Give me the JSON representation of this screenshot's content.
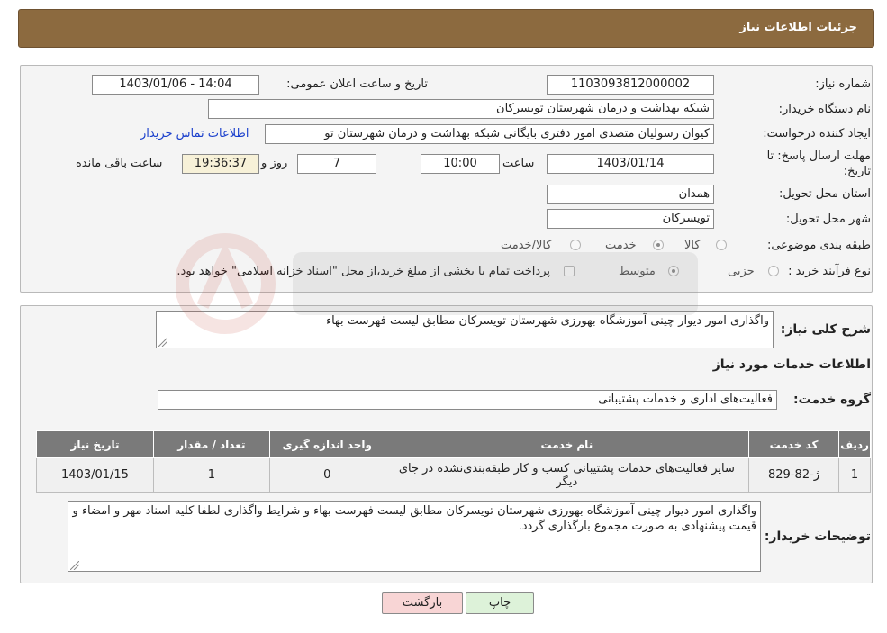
{
  "header": {
    "title": "جزئیات اطلاعات نیاز"
  },
  "form": {
    "need_number_label": "شماره نیاز:",
    "need_number": "1103093812000002",
    "announce_label": "تاریخ و ساعت اعلان عمومی:",
    "announce_value": "1403/01/06 - 14:04",
    "buyer_org_label": "نام دستگاه خریدار:",
    "buyer_org": "شبکه بهداشت و درمان شهرستان تویسرکان",
    "creator_label": "ایجاد کننده درخواست:",
    "creator": "کیوان رسولیان متصدی امور دفتری بایگانی شبکه بهداشت و درمان شهرستان تو",
    "contact_link": "اطلاعات تماس خریدار",
    "deadline_label_1": "مهلت ارسال پاسخ: تا",
    "deadline_label_2": "تاریخ:",
    "deadline_date": "1403/01/14",
    "time_label": "ساعت",
    "deadline_time": "10:00",
    "days_value": "7",
    "days_label": "روز و",
    "remaining_time": "19:36:37",
    "remaining_label": "ساعت باقی مانده",
    "province_label": "استان محل تحویل:",
    "province": "همدان",
    "city_label": "شهر محل تحویل:",
    "city": "تویسرکان",
    "category_label": "طبقه بندی موضوعی:",
    "category_options": [
      "کالا",
      "خدمت",
      "کالا/خدمت"
    ],
    "process_label": "نوع فرآیند خرید :",
    "process_options": [
      "جزیی",
      "متوسط"
    ],
    "payment_note": "پرداخت تمام یا بخشی از مبلغ خرید،از محل \"اسناد خزانه اسلامی\" خواهد بود."
  },
  "details": {
    "summary_label": "شرح کلی نیاز:",
    "summary": "واگذاری امور دیوار چینی آموزشگاه بهورزی شهرستان تویسرکان مطابق لیست فهرست بهاء",
    "services_title": "اطلاعات خدمات مورد نیاز",
    "service_group_label": "گروه خدمت:",
    "service_group": "فعالیت‌های اداری و خدمات پشتیبانی",
    "table": {
      "headers": [
        "ردیف",
        "کد خدمت",
        "نام خدمت",
        "واحد اندازه گیری",
        "تعداد / مقدار",
        "تاریخ نیاز"
      ],
      "rows": [
        [
          "1",
          "ژ-82-829",
          "سایر فعالیت‌های خدمات پشتیبانی کسب و کار طبقه‌بندی‌نشده در جای دیگر",
          "0",
          "1",
          "1403/01/15"
        ]
      ]
    },
    "buyer_notes_label": "توضیحات خریدار:",
    "buyer_notes": "واگذاری امور دیوار چینی آموزشگاه بهورزی شهرستان تویسرکان مطابق لیست فهرست بهاء و شرایط واگذاری لطفا کلیه اسناد مهر و امضاء و قیمت پیشنهادی به صورت مجموع بارگذاری گردد."
  },
  "buttons": {
    "print": "چاپ",
    "back": "بازگشت"
  },
  "colors": {
    "header_bg": "#8c6a3f",
    "table_header_bg": "#7a7a7a",
    "back_btn": "#f8d5d5",
    "print_btn": "#ddf2d9",
    "link": "#1a3fcc"
  }
}
